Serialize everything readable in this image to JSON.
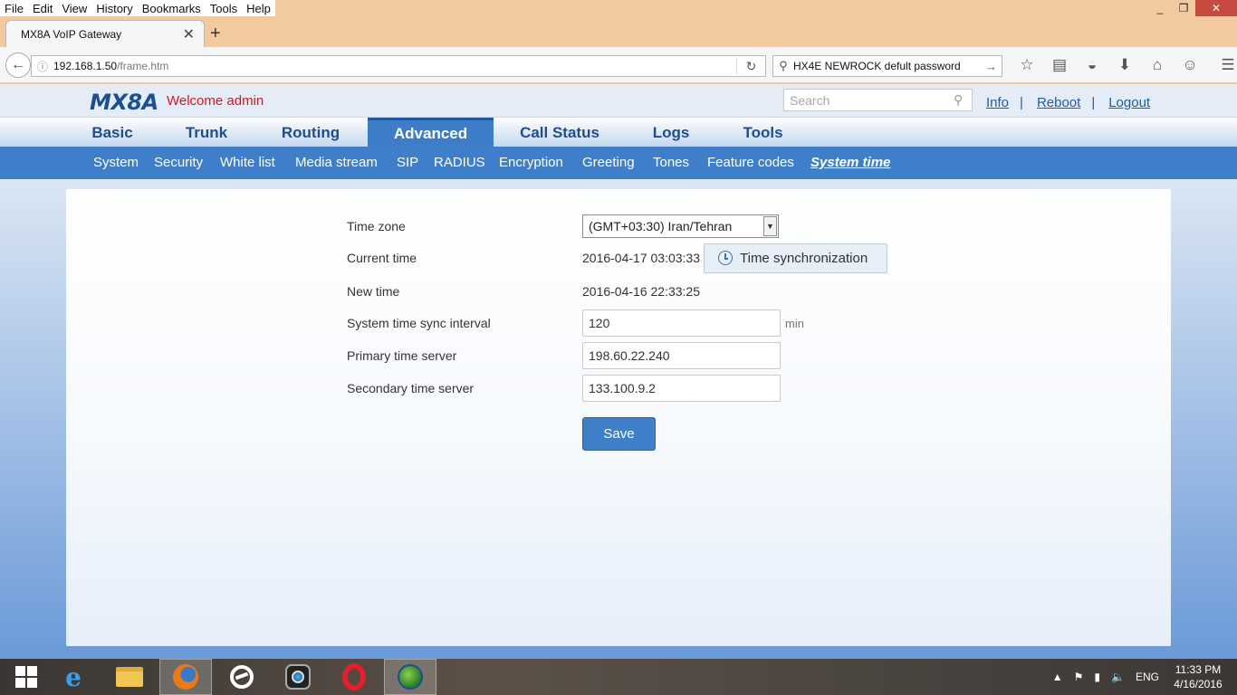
{
  "browser": {
    "menu": [
      "File",
      "Edit",
      "View",
      "History",
      "Bookmarks",
      "Tools",
      "Help"
    ],
    "window_controls": [
      "_",
      "❐",
      "✕"
    ],
    "tab_title": "MX8A VoIP Gateway",
    "url_host": "192.168.1.50",
    "url_path": "/frame.htm",
    "search_query": "HX4E NEWROCK defult password"
  },
  "header": {
    "logo": "MX8A",
    "welcome": "Welcome admin",
    "search_placeholder": "Search",
    "links": {
      "info": "Info",
      "reboot": "Reboot",
      "logout": "Logout"
    },
    "sep": "|"
  },
  "main_nav": [
    {
      "label": "Basic",
      "active": false
    },
    {
      "label": "Trunk",
      "active": false
    },
    {
      "label": "Routing",
      "active": false
    },
    {
      "label": "Advanced",
      "active": true
    },
    {
      "label": "Call Status",
      "active": false
    },
    {
      "label": "Logs",
      "active": false
    },
    {
      "label": "Tools",
      "active": false
    }
  ],
  "sub_nav": [
    {
      "label": "System",
      "active": false
    },
    {
      "label": "Security",
      "active": false
    },
    {
      "label": "White list",
      "active": false
    },
    {
      "label": "Media stream",
      "active": false
    },
    {
      "label": "SIP",
      "active": false
    },
    {
      "label": "RADIUS",
      "active": false
    },
    {
      "label": "Encryption",
      "active": false
    },
    {
      "label": "Greeting",
      "active": false
    },
    {
      "label": "Tones",
      "active": false
    },
    {
      "label": "Feature codes",
      "active": false
    },
    {
      "label": "System time",
      "active": true
    }
  ],
  "form": {
    "time_zone_label": "Time zone",
    "time_zone_value": "(GMT+03:30) Iran/Tehran",
    "current_time_label": "Current time",
    "current_time_value": "2016-04-17 03:03:33",
    "sync_button": "Time synchronization",
    "new_time_label": "New time",
    "new_time_value": "2016-04-16 22:33:25",
    "sync_interval_label": "System time sync interval",
    "sync_interval_value": "120",
    "sync_interval_unit": "min",
    "primary_server_label": "Primary time server",
    "primary_server_value": "198.60.22.240",
    "secondary_server_label": "Secondary time server",
    "secondary_server_value": "133.100.9.2",
    "save_button": "Save"
  },
  "taskbar": {
    "lang": "ENG",
    "time": "11:33 PM",
    "date": "4/16/2016"
  },
  "colors": {
    "accent": "#3f7fca",
    "nav_text": "#1f4e8f",
    "welcome": "#d9161b",
    "link": "#1f5ba7"
  }
}
